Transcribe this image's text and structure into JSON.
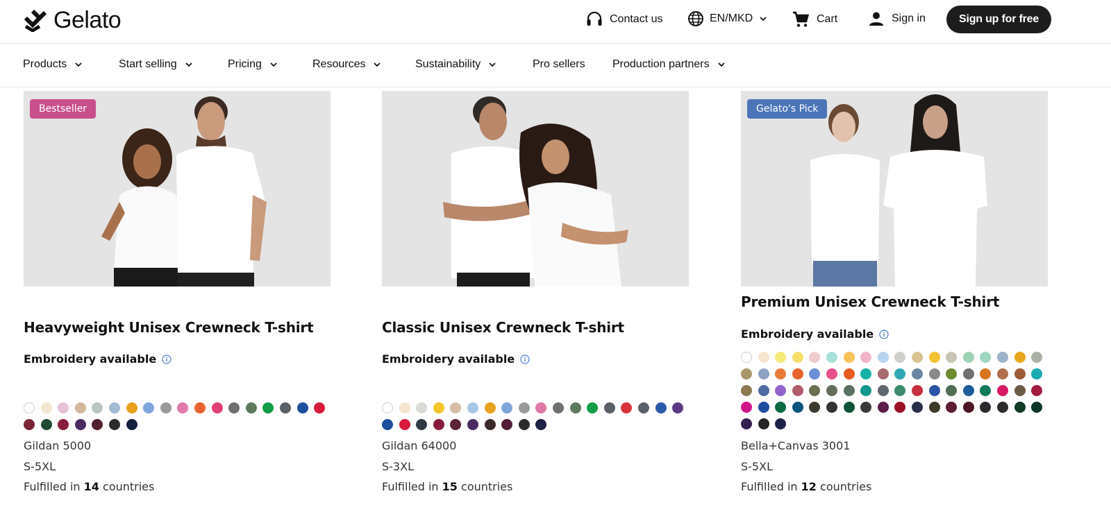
{
  "header": {
    "logo_text": "Gelato",
    "contact": "Contact us",
    "language": "EN/MKD",
    "cart": "Cart",
    "sign_in": "Sign in",
    "sign_up": "Sign up for free"
  },
  "nav": {
    "items": [
      {
        "label": "Products",
        "has_dropdown": true
      },
      {
        "label": "Start selling",
        "has_dropdown": true
      },
      {
        "label": "Pricing",
        "has_dropdown": true
      },
      {
        "label": "Resources",
        "has_dropdown": true
      },
      {
        "label": "Sustainability",
        "has_dropdown": true
      },
      {
        "label": "Pro sellers",
        "has_dropdown": false
      },
      {
        "label": "Production partners",
        "has_dropdown": true
      }
    ]
  },
  "products": [
    {
      "badge": "Bestseller",
      "badge_color": "#c94f8c",
      "title": "Heavyweight Unisex Crewneck T-shirt",
      "embroidery": "Embroidery available",
      "colors": [
        "#ffffff",
        "#f4e6cf",
        "#e6c3d6",
        "#d4b89c",
        "#b9c5c2",
        "#a3bcd3",
        "#e8a21e",
        "#7fa6dc",
        "#9a9a9a",
        "#e07aa9",
        "#e8622b",
        "#e03f78",
        "#707070",
        "#5d7a5e",
        "#129d46",
        "#5b5f68",
        "#1c4f9c",
        "#d81a3b",
        "#7a2536",
        "#214a33",
        "#8a1d3c",
        "#4a2b62",
        "#54222f",
        "#2b2b2b",
        "#14203d"
      ],
      "model": "Gildan 5000",
      "sizes": "S-5XL",
      "fulfilled_prefix": "Fulfilled in",
      "countries": "14",
      "fulfilled_suffix": "countries"
    },
    {
      "badge": "",
      "badge_color": "",
      "title": "Classic Unisex Crewneck T-shirt",
      "embroidery": "Embroidery available",
      "colors": [
        "#ffffff",
        "#f4e6cf",
        "#dcdad6",
        "#f4c52f",
        "#d6bfa6",
        "#a6c8e6",
        "#e8a21e",
        "#7fa6dc",
        "#9a9a9a",
        "#e07aa9",
        "#707070",
        "#5d7a5e",
        "#129d46",
        "#5b5f68",
        "#d8343a",
        "#5b5f68",
        "#2a5aa8",
        "#5b3a84",
        "#1c4f9c",
        "#d81a3b",
        "#2f3b45",
        "#8a1d3c",
        "#5a2538",
        "#4a2b62",
        "#3b2a2a",
        "#521d35",
        "#2b2b2b",
        "#1d2244"
      ],
      "model": "Gildan 64000",
      "sizes": "S-3XL",
      "fulfilled_prefix": "Fulfilled in",
      "countries": "15",
      "fulfilled_suffix": "countries"
    },
    {
      "badge": "Gelato's Pick",
      "badge_color": "#4b75b8",
      "title": "Premium Unisex Crewneck T-shirt",
      "embroidery": "Embroidery available",
      "colors": [
        "#ffffff",
        "#f6e6cf",
        "#f6ea7a",
        "#f5df6a",
        "#efcccd",
        "#a8e1d9",
        "#f7c35a",
        "#f0b6c8",
        "#b7d4f0",
        "#d0d0cb",
        "#d8c393",
        "#f1c232",
        "#c9c5b5",
        "#9fd3b4",
        "#9ed6c0",
        "#9db3c9",
        "#e8a61c",
        "#a9b1a5",
        "#a89768",
        "#8ea2c3",
        "#e87a39",
        "#e8632b",
        "#6c8fd8",
        "#e8508a",
        "#e85b20",
        "#17b0a6",
        "#a76a6f",
        "#2fa7b3",
        "#6c87a3",
        "#8a8a8a",
        "#6e8b2e",
        "#707070",
        "#d9751f",
        "#b07050",
        "#9a5a35",
        "#18aab0",
        "#8b7a50",
        "#4d6aa0",
        "#8f63c9",
        "#b05a6a",
        "#6a7050",
        "#646f5a",
        "#5a7060",
        "#13968e",
        "#5e6670",
        "#3c8a6b",
        "#c62e3d",
        "#2d55a8",
        "#4f6f55",
        "#1c5c9c",
        "#0e7a5a",
        "#d91a65",
        "#6b5a45",
        "#a31d40",
        "#d1148a",
        "#1e4ea0",
        "#0b6a42",
        "#06527a",
        "#3c3a30",
        "#333333",
        "#0d5437",
        "#383838",
        "#5c1d47",
        "#9b0f25",
        "#2a2f4a",
        "#3e3a28",
        "#5e1d30",
        "#4d1623",
        "#2b2a2e",
        "#2d2a2a",
        "#0f3a24",
        "#0e3626",
        "#34204f",
        "#262626",
        "#1b2349"
      ],
      "model": "Bella+Canvas 3001",
      "sizes": "S-5XL",
      "fulfilled_prefix": "Fulfilled in",
      "countries": "12",
      "fulfilled_suffix": "countries"
    }
  ]
}
